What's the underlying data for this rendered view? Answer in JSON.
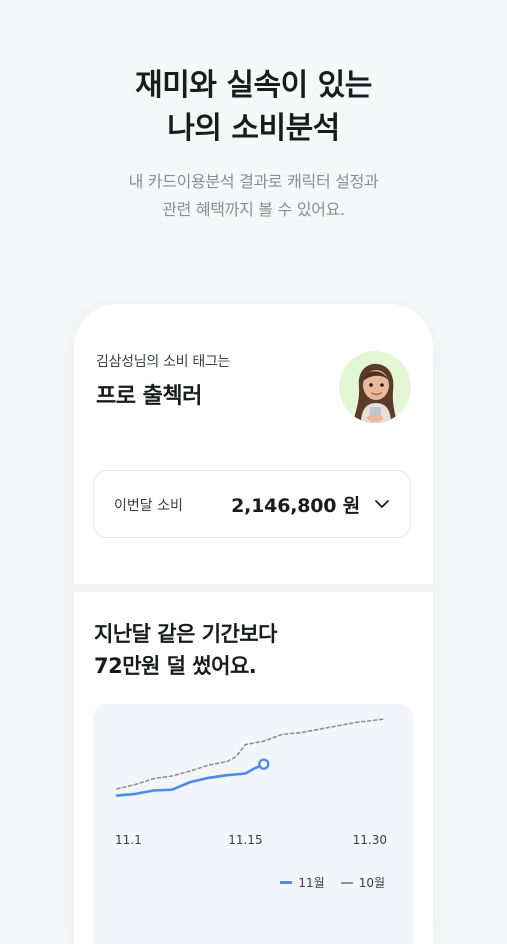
{
  "hero": {
    "title_line1": "재미와 실속이 있는",
    "title_line2": "나의 소비분석",
    "sub_line1": "내 카드이용분석 결과로 캐릭터 설정과",
    "sub_line2": "관련 혜택까지 볼 수 있어요."
  },
  "profile": {
    "tag_caption": "김삼성님의 소비 태그는",
    "tag_name": "프로 출첵러",
    "avatar_icon": "character-avatar-icon"
  },
  "spend": {
    "label": "이번달 소비",
    "amount": "2,146,800 원",
    "dropdown_icon": "chevron-down-icon"
  },
  "comparison": {
    "line1": "지난달 같은 기간보다",
    "line2": "72만원 덜 썼어요."
  },
  "chart_data": {
    "type": "line",
    "x_ticks": [
      "11.1",
      "11.15",
      "11.30"
    ],
    "series": [
      {
        "name": "11월",
        "style": "solid",
        "color": "#4a8df0",
        "x": [
          1,
          3,
          5,
          7,
          9,
          11,
          13,
          15,
          16,
          17
        ],
        "values": [
          12,
          13,
          15,
          15.5,
          20,
          22.5,
          24,
          25,
          28,
          30.5
        ]
      },
      {
        "name": "10월",
        "style": "dashed",
        "color": "#8c8f94",
        "x": [
          1,
          3,
          5,
          7,
          9,
          11,
          13,
          14,
          15,
          17,
          19,
          21,
          23,
          25,
          27,
          30
        ],
        "values": [
          16,
          18.5,
          22,
          23.5,
          26.5,
          30,
          32,
          35,
          42,
          44,
          48,
          49,
          51,
          53,
          55,
          57
        ]
      }
    ],
    "xlim": [
      1,
      30
    ],
    "ylim": [
      0,
      60
    ],
    "grid": false,
    "legend_position": "bottom-right"
  },
  "legend": {
    "current": "11월",
    "previous": "10월"
  }
}
